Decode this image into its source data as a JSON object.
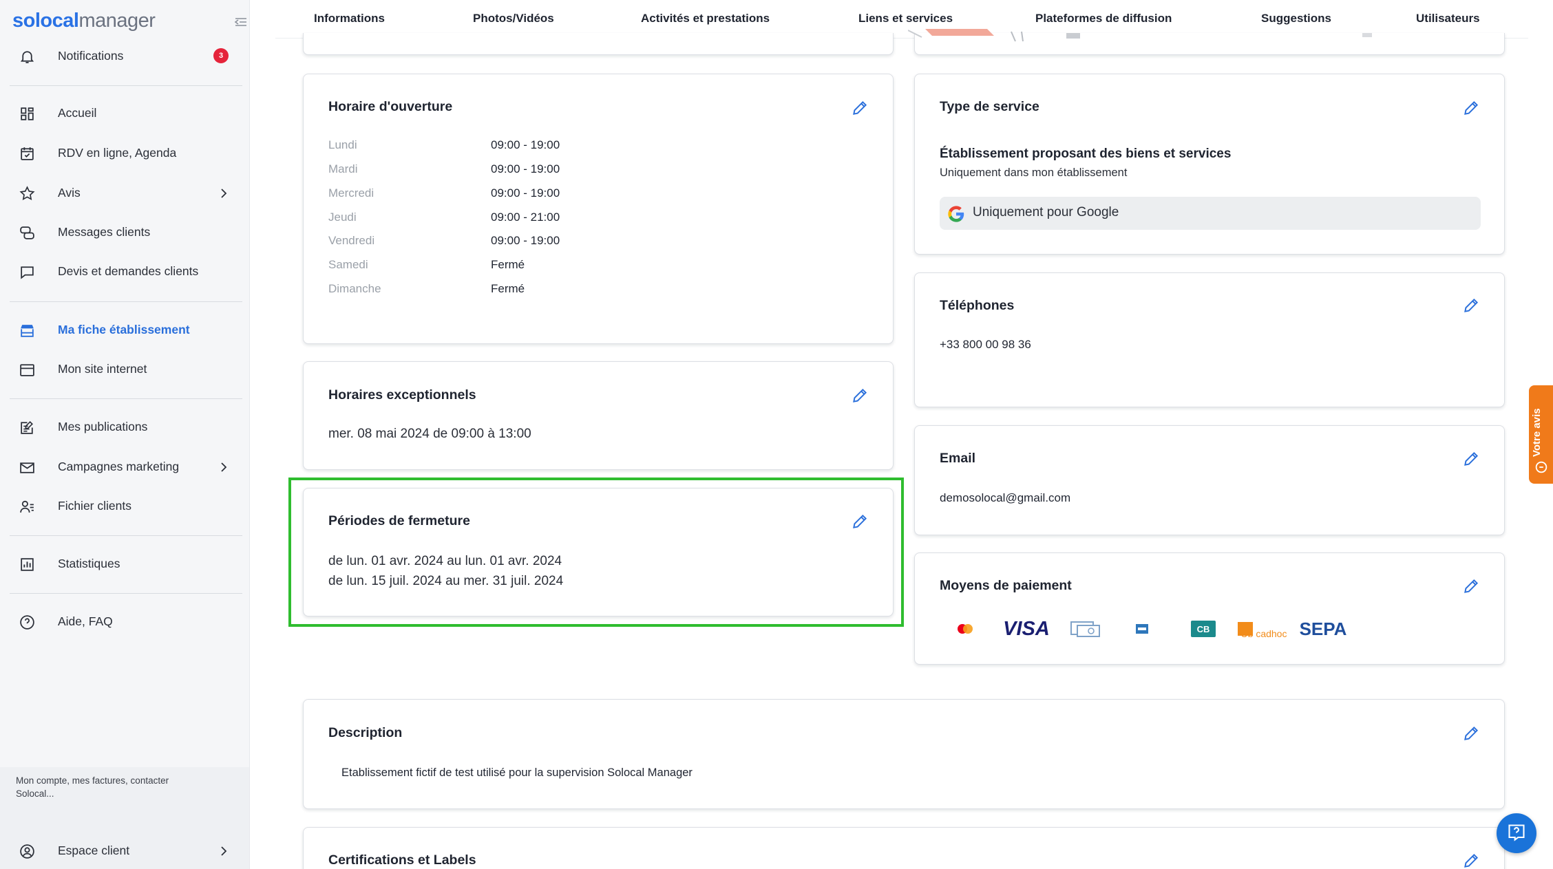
{
  "logo": {
    "part1": "solocal",
    "part2": "manager"
  },
  "sidebar": {
    "notifications": {
      "label": "Notifications",
      "count": "3"
    },
    "items": [
      {
        "label": "Accueil"
      },
      {
        "label": "RDV en ligne, Agenda"
      },
      {
        "label": "Avis"
      },
      {
        "label": "Messages clients"
      },
      {
        "label": "Devis et demandes clients"
      },
      {
        "label": "Ma fiche établissement"
      },
      {
        "label": "Mon site internet"
      },
      {
        "label": "Mes publications"
      },
      {
        "label": "Campagnes marketing"
      },
      {
        "label": "Fichier clients"
      },
      {
        "label": "Statistiques"
      },
      {
        "label": "Aide, FAQ"
      }
    ],
    "account_text": "Mon compte, mes factures, contacter Solocal...",
    "espace_client": "Espace client"
  },
  "tabs": [
    "Informations",
    "Photos/Vidéos",
    "Activités et prestations",
    "Liens et services",
    "Plateformes de diffusion",
    "Suggestions",
    "Utilisateurs"
  ],
  "hours": {
    "title": "Horaire d'ouverture",
    "days": [
      {
        "day": "Lundi",
        "value": "09:00 - 19:00"
      },
      {
        "day": "Mardi",
        "value": "09:00 - 19:00"
      },
      {
        "day": "Mercredi",
        "value": "09:00 - 19:00"
      },
      {
        "day": "Jeudi",
        "value": "09:00 - 21:00"
      },
      {
        "day": "Vendredi",
        "value": "09:00 - 19:00"
      },
      {
        "day": "Samedi",
        "value": "Fermé"
      },
      {
        "day": "Dimanche",
        "value": "Fermé"
      }
    ]
  },
  "exceptional": {
    "title": "Horaires exceptionnels",
    "line": "mer. 08 mai 2024 de 09:00 à 13:00"
  },
  "closures": {
    "title": "Périodes de fermeture",
    "lines": [
      "de lun. 01 avr. 2024 au lun. 01 avr. 2024",
      "de lun. 15 juil. 2024 au mer. 31 juil. 2024"
    ]
  },
  "service": {
    "title": "Type de service",
    "heading": "Établissement proposant des biens et services",
    "sub": "Uniquement dans mon établissement",
    "google": "Uniquement pour Google"
  },
  "phones": {
    "title": "Téléphones",
    "value": "+33 800 00 98 36"
  },
  "email": {
    "title": "Email",
    "value": "demosolocal@gmail.com"
  },
  "payment": {
    "title": "Moyens de paiement",
    "methods": [
      "mastercard",
      "VISA",
      "cheque",
      "amex",
      "CB",
      "Up cadhoc",
      "SEPA"
    ]
  },
  "description": {
    "title": "Description",
    "text": "Etablissement fictif de test utilisé pour la supervision Solocal Manager"
  },
  "certifications": {
    "title": "Certifications et Labels"
  },
  "feedback": {
    "label": "Votre avis"
  },
  "colors": {
    "accent": "#2a6fdb",
    "highlight": "#2fbd2f",
    "badge": "#e5243b",
    "feedback": "#f07a1a"
  }
}
